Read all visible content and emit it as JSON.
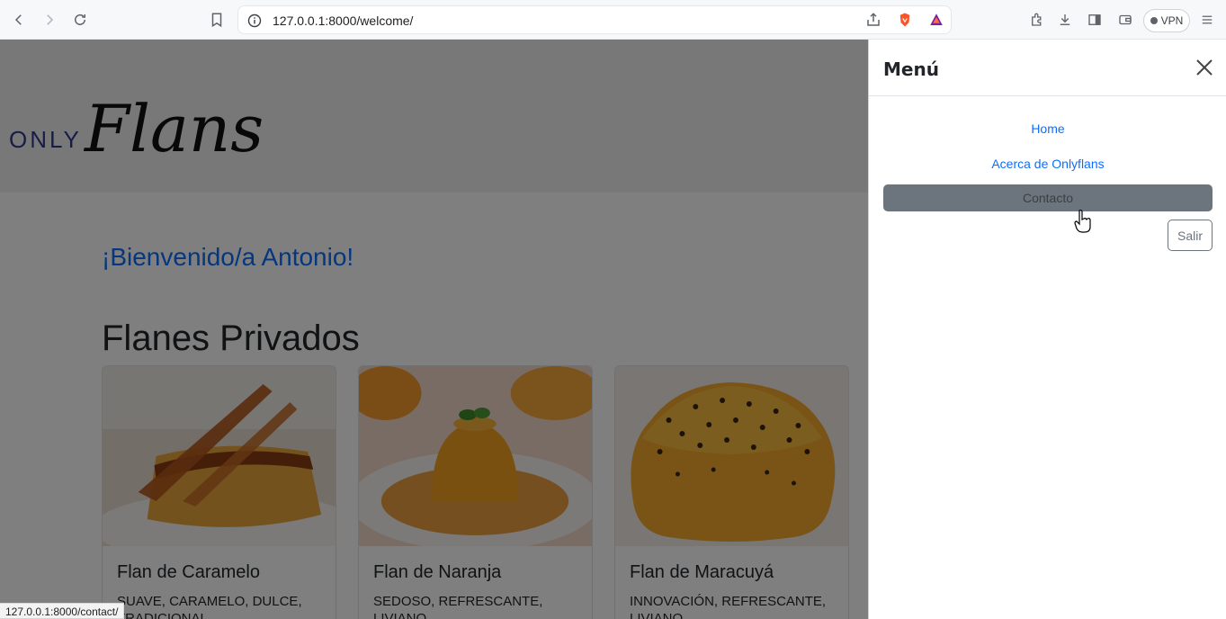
{
  "browser": {
    "url": "127.0.0.1:8000/welcome/",
    "vpn_label": "VPN",
    "status_url": "127.0.0.1:8000/contact/"
  },
  "page": {
    "logo_only": "ONLY",
    "logo_flans": "Flans",
    "welcome": "¡Bienvenido/a Antonio!",
    "section_title": "Flanes Privados",
    "cards": [
      {
        "title": "Flan de Caramelo",
        "text": "SUAVE, CARAMELO, DULCE, TRADICIONAL"
      },
      {
        "title": "Flan de Naranja",
        "text": "SEDOSO, REFRESCANTE, LIVIANO"
      },
      {
        "title": "Flan de Maracuyá",
        "text": "INNOVACIÓN, REFRESCANTE, LIVIANO"
      }
    ]
  },
  "offcanvas": {
    "title": "Menú",
    "links": [
      "Home",
      "Acerca de Onlyflans",
      "Contacto"
    ],
    "active_link": "Contacto",
    "logout_label": "Salir"
  },
  "colors": {
    "link": "#0d6efd",
    "active_bg": "#6c757d",
    "logo_blue": "#2f3a8f"
  }
}
